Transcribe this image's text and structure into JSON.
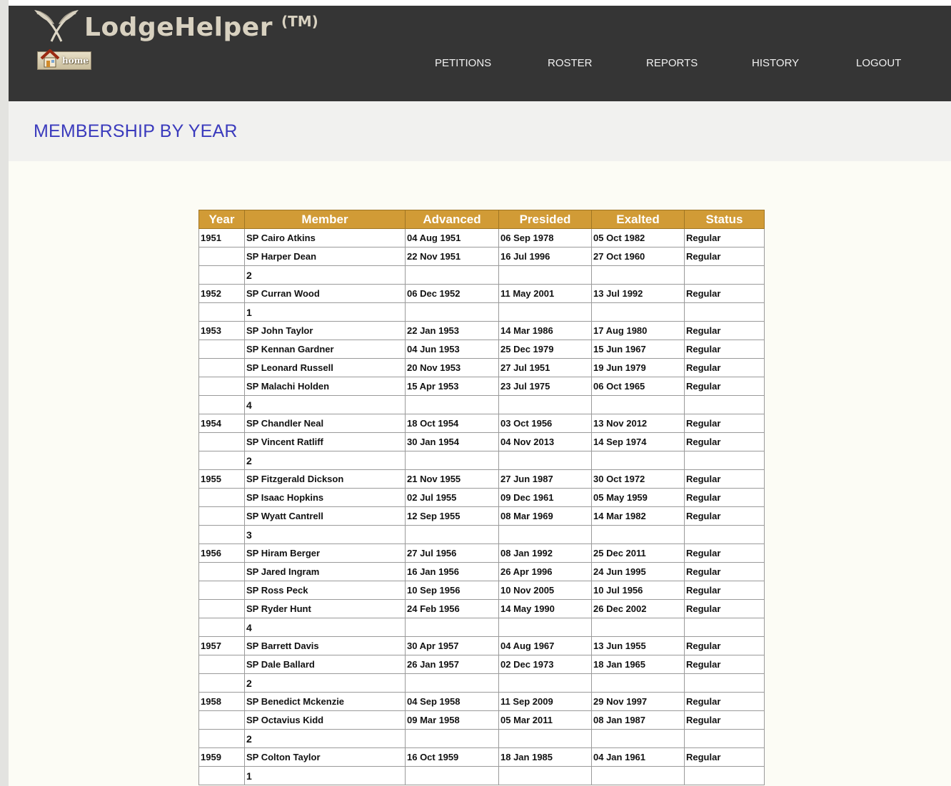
{
  "app": {
    "logo_text": "LodgeHelper",
    "tm": "(TM)",
    "home_label": "home"
  },
  "nav": {
    "items": [
      {
        "label": "PETITIONS"
      },
      {
        "label": "ROSTER"
      },
      {
        "label": "REPORTS"
      },
      {
        "label": "HISTORY"
      },
      {
        "label": "LOGOUT"
      }
    ]
  },
  "page": {
    "title": "MEMBERSHIP BY YEAR"
  },
  "table": {
    "columns": [
      "Year",
      "Member",
      "Advanced",
      "Presided",
      "Exalted",
      "Status"
    ],
    "rows": [
      {
        "year": "1951",
        "member": "SP Cairo Atkins",
        "advanced": "04 Aug 1951",
        "presided": "06 Sep 1978",
        "exalted": "05 Oct 1982",
        "status": "Regular"
      },
      {
        "year": "",
        "member": "SP Harper Dean",
        "advanced": "22 Nov 1951",
        "presided": "16 Jul 1996",
        "exalted": "27 Oct 1960",
        "status": "Regular"
      },
      {
        "year": "",
        "member": "2",
        "advanced": "",
        "presided": "",
        "exalted": "",
        "status": "",
        "count": true
      },
      {
        "year": "1952",
        "member": "SP Curran Wood",
        "advanced": "06 Dec 1952",
        "presided": "11 May 2001",
        "exalted": "13 Jul 1992",
        "status": "Regular"
      },
      {
        "year": "",
        "member": "1",
        "advanced": "",
        "presided": "",
        "exalted": "",
        "status": "",
        "count": true
      },
      {
        "year": "1953",
        "member": "SP John Taylor",
        "advanced": "22 Jan 1953",
        "presided": "14 Mar 1986",
        "exalted": "17 Aug 1980",
        "status": "Regular"
      },
      {
        "year": "",
        "member": "SP Kennan Gardner",
        "advanced": "04 Jun 1953",
        "presided": "25 Dec 1979",
        "exalted": "15 Jun 1967",
        "status": "Regular"
      },
      {
        "year": "",
        "member": "SP Leonard Russell",
        "advanced": "20 Nov 1953",
        "presided": "27 Jul 1951",
        "exalted": "19 Jun 1979",
        "status": "Regular"
      },
      {
        "year": "",
        "member": "SP Malachi Holden",
        "advanced": "15 Apr 1953",
        "presided": "23 Jul 1975",
        "exalted": "06 Oct 1965",
        "status": "Regular"
      },
      {
        "year": "",
        "member": "4",
        "advanced": "",
        "presided": "",
        "exalted": "",
        "status": "",
        "count": true
      },
      {
        "year": "1954",
        "member": "SP Chandler Neal",
        "advanced": "18 Oct 1954",
        "presided": "03 Oct 1956",
        "exalted": "13 Nov 2012",
        "status": "Regular"
      },
      {
        "year": "",
        "member": "SP Vincent Ratliff",
        "advanced": "30 Jan 1954",
        "presided": "04 Nov 2013",
        "exalted": "14 Sep 1974",
        "status": "Regular"
      },
      {
        "year": "",
        "member": "2",
        "advanced": "",
        "presided": "",
        "exalted": "",
        "status": "",
        "count": true
      },
      {
        "year": "1955",
        "member": "SP Fitzgerald Dickson",
        "advanced": "21 Nov 1955",
        "presided": "27 Jun 1987",
        "exalted": "30 Oct 1972",
        "status": "Regular"
      },
      {
        "year": "",
        "member": "SP Isaac Hopkins",
        "advanced": "02 Jul 1955",
        "presided": "09 Dec 1961",
        "exalted": "05 May 1959",
        "status": "Regular"
      },
      {
        "year": "",
        "member": "SP Wyatt Cantrell",
        "advanced": "12 Sep 1955",
        "presided": "08 Mar 1969",
        "exalted": "14 Mar 1982",
        "status": "Regular"
      },
      {
        "year": "",
        "member": "3",
        "advanced": "",
        "presided": "",
        "exalted": "",
        "status": "",
        "count": true
      },
      {
        "year": "1956",
        "member": "SP Hiram Berger",
        "advanced": "27 Jul 1956",
        "presided": "08 Jan 1992",
        "exalted": "25 Dec 2011",
        "status": "Regular"
      },
      {
        "year": "",
        "member": "SP Jared Ingram",
        "advanced": "16 Jan 1956",
        "presided": "26 Apr 1996",
        "exalted": "24 Jun 1995",
        "status": "Regular"
      },
      {
        "year": "",
        "member": "SP Ross Peck",
        "advanced": "10 Sep 1956",
        "presided": "10 Nov 2005",
        "exalted": "10 Jul 1956",
        "status": "Regular"
      },
      {
        "year": "",
        "member": "SP Ryder Hunt",
        "advanced": "24 Feb 1956",
        "presided": "14 May 1990",
        "exalted": "26 Dec 2002",
        "status": "Regular"
      },
      {
        "year": "",
        "member": "4",
        "advanced": "",
        "presided": "",
        "exalted": "",
        "status": "",
        "count": true
      },
      {
        "year": "1957",
        "member": "SP Barrett Davis",
        "advanced": "30 Apr 1957",
        "presided": "04 Aug 1967",
        "exalted": "13 Jun 1955",
        "status": "Regular"
      },
      {
        "year": "",
        "member": "SP Dale Ballard",
        "advanced": "26 Jan 1957",
        "presided": "02 Dec 1973",
        "exalted": "18 Jan 1965",
        "status": "Regular"
      },
      {
        "year": "",
        "member": "2",
        "advanced": "",
        "presided": "",
        "exalted": "",
        "status": "",
        "count": true
      },
      {
        "year": "1958",
        "member": "SP Benedict Mckenzie",
        "advanced": "04 Sep 1958",
        "presided": "11 Sep 2009",
        "exalted": "29 Nov 1997",
        "status": "Regular"
      },
      {
        "year": "",
        "member": "SP Octavius Kidd",
        "advanced": "09 Mar 1958",
        "presided": "05 Mar 2011",
        "exalted": "08 Jan 1987",
        "status": "Regular"
      },
      {
        "year": "",
        "member": "2",
        "advanced": "",
        "presided": "",
        "exalted": "",
        "status": "",
        "count": true
      },
      {
        "year": "1959",
        "member": "SP Colton Taylor",
        "advanced": "16 Oct 1959",
        "presided": "18 Jan 1985",
        "exalted": "04 Jan 1961",
        "status": "Regular"
      },
      {
        "year": "",
        "member": "1",
        "advanced": "",
        "presided": "",
        "exalted": "",
        "status": "",
        "count": true
      }
    ]
  },
  "colors": {
    "header_bg": "#353535",
    "table_header_bg": "#d19b36",
    "title_color": "#3b3bbd"
  }
}
